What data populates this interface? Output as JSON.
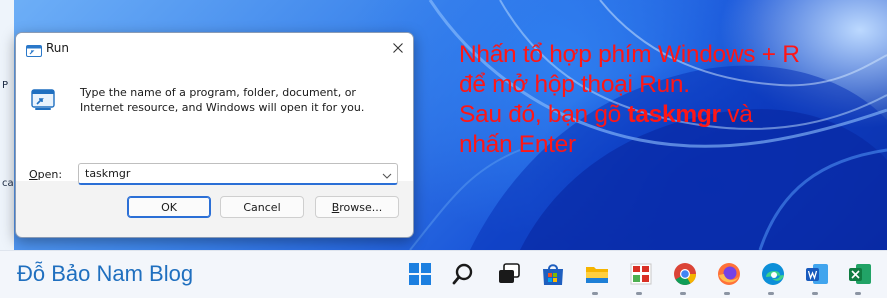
{
  "dialog": {
    "title": "Run",
    "description": "Type the name of a program, folder, document, or Internet resource, and Windows will open it for you.",
    "open_label_key": "O",
    "open_label_rest": "pen:",
    "input_value": "taskmgr",
    "ok_label": "OK",
    "cancel_label": "Cancel",
    "browse_label_key": "B",
    "browse_label_rest": "rowse..."
  },
  "caption": {
    "line1": "Nhấn tổ hợp phím Windows + R",
    "line2": "để mở hộp thoại Run.",
    "line3_pre": "Sau đó, bạn gõ ",
    "line3_bold": "taskmgr",
    "line3_post": " và",
    "line4": "nhấn Enter"
  },
  "desktop_fragments": [
    "P",
    "ca"
  ],
  "taskbar": {
    "brand": "Đỗ Bảo Nam Blog",
    "icons": [
      "start-icon",
      "search-icon",
      "task-view-icon",
      "store-icon",
      "file-explorer-icon",
      "snipping-tool-icon",
      "chrome-icon",
      "firefox-icon",
      "edge-icon",
      "word-icon",
      "excel-icon"
    ]
  },
  "colors": {
    "caption": "#ff1616",
    "accent": "#2b6fd6",
    "brand": "#1f6fbf"
  }
}
